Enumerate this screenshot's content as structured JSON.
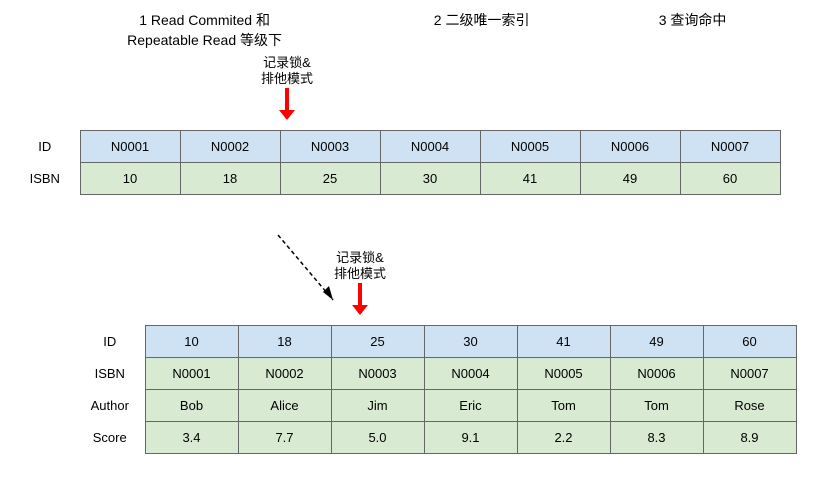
{
  "headers": {
    "h1": "1 Read Commited 和 Repeatable Read 等级下",
    "h2": "2 二级唯一索引",
    "h3": "3 查询命中"
  },
  "annotations": {
    "lock1_line1": "记录锁&",
    "lock1_line2": "排他模式",
    "lock2_line1": "记录锁&",
    "lock2_line2": "排他模式"
  },
  "table1": {
    "row_labels": {
      "id": "ID",
      "isbn": "ISBN"
    },
    "id_row": [
      "N0001",
      "N0002",
      "N0003",
      "N0004",
      "N0005",
      "N0006",
      "N0007"
    ],
    "isbn_row": [
      "10",
      "18",
      "25",
      "30",
      "41",
      "49",
      "60"
    ]
  },
  "table2": {
    "row_labels": {
      "id": "ID",
      "isbn": "ISBN",
      "author": "Author",
      "score": "Score"
    },
    "id_row": [
      "10",
      "18",
      "25",
      "30",
      "41",
      "49",
      "60"
    ],
    "isbn_row": [
      "N0001",
      "N0002",
      "N0003",
      "N0004",
      "N0005",
      "N0006",
      "N0007"
    ],
    "author_row": [
      "Bob",
      "Alice",
      "Jim",
      "Eric",
      "Tom",
      "Tom",
      "Rose"
    ],
    "score_row": [
      "3.4",
      "7.7",
      "5.0",
      "9.1",
      "2.2",
      "8.3",
      "8.9"
    ]
  }
}
